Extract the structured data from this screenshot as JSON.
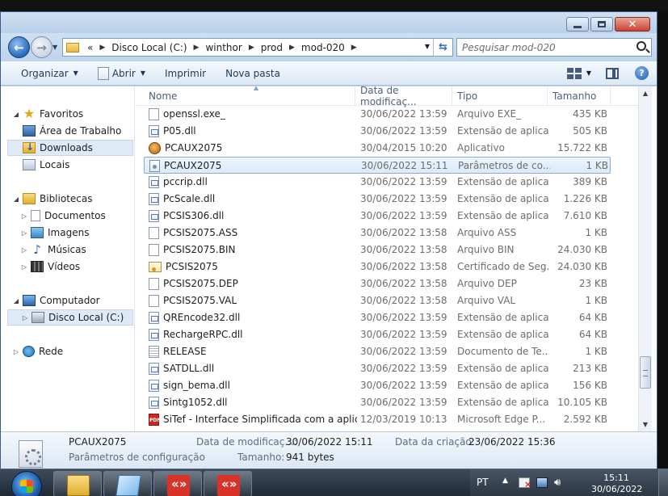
{
  "window": {
    "address_crumbs": [
      "Disco Local (C:)",
      "winthor",
      "prod",
      "mod-020"
    ],
    "search_placeholder": "Pesquisar mod-020",
    "address_overflow": "«"
  },
  "toolbar": {
    "organize": "Organizar",
    "open": "Abrir",
    "print": "Imprimir",
    "new_folder": "Nova pasta"
  },
  "navpane": {
    "favorites": "Favoritos",
    "desktop": "Área de Trabalho",
    "downloads": "Downloads",
    "places": "Locais",
    "libraries": "Bibliotecas",
    "documents": "Documentos",
    "images": "Imagens",
    "music": "Músicas",
    "videos": "Vídeos",
    "computer": "Computador",
    "local_disk": "Disco Local (C:)",
    "network": "Rede"
  },
  "columns": {
    "name": "Nome",
    "date": "Data de modificaç...",
    "type": "Tipo",
    "size": "Tamanho"
  },
  "files": [
    {
      "name": "openssl.exe_",
      "date": "30/06/2022 13:59",
      "type": "Arquivo EXE_",
      "size": "435 KB",
      "icon": "file"
    },
    {
      "name": "P05.dll",
      "date": "30/06/2022 13:59",
      "type": "Extensão de aplica...",
      "size": "505 KB",
      "icon": "dll"
    },
    {
      "name": "PCAUX2075",
      "date": "30/04/2015 10:20",
      "type": "Aplicativo",
      "size": "15.722 KB",
      "icon": "app"
    },
    {
      "name": "PCAUX2075",
      "date": "30/06/2022 15:11",
      "type": "Parâmetros de co...",
      "size": "1 KB",
      "icon": "cfg",
      "selected": true
    },
    {
      "name": "pccrip.dll",
      "date": "30/06/2022 13:59",
      "type": "Extensão de aplica...",
      "size": "389 KB",
      "icon": "dll"
    },
    {
      "name": "PcScale.dll",
      "date": "30/06/2022 13:59",
      "type": "Extensão de aplica...",
      "size": "1.226 KB",
      "icon": "dll"
    },
    {
      "name": "PCSIS306.dll",
      "date": "30/06/2022 13:59",
      "type": "Extensão de aplica...",
      "size": "7.610 KB",
      "icon": "dll"
    },
    {
      "name": "PCSIS2075.ASS",
      "date": "30/06/2022 13:58",
      "type": "Arquivo ASS",
      "size": "1 KB",
      "icon": "file"
    },
    {
      "name": "PCSIS2075.BIN",
      "date": "30/06/2022 13:58",
      "type": "Arquivo BIN",
      "size": "24.030 KB",
      "icon": "file"
    },
    {
      "name": "PCSIS2075",
      "date": "30/06/2022 13:58",
      "type": "Certificado de Seg...",
      "size": "24.030 KB",
      "icon": "cert"
    },
    {
      "name": "PCSIS2075.DEP",
      "date": "30/06/2022 13:58",
      "type": "Arquivo DEP",
      "size": "23 KB",
      "icon": "file"
    },
    {
      "name": "PCSIS2075.VAL",
      "date": "30/06/2022 13:58",
      "type": "Arquivo VAL",
      "size": "1 KB",
      "icon": "file"
    },
    {
      "name": "QREncode32.dll",
      "date": "30/06/2022 13:59",
      "type": "Extensão de aplica...",
      "size": "64 KB",
      "icon": "dll"
    },
    {
      "name": "RechargeRPC.dll",
      "date": "30/06/2022 13:59",
      "type": "Extensão de aplica...",
      "size": "64 KB",
      "icon": "dll"
    },
    {
      "name": "RELEASE",
      "date": "30/06/2022 13:59",
      "type": "Documento de Te...",
      "size": "1 KB",
      "icon": "txt"
    },
    {
      "name": "SATDLL.dll",
      "date": "30/06/2022 13:59",
      "type": "Extensão de aplica...",
      "size": "213 KB",
      "icon": "dll"
    },
    {
      "name": "sign_bema.dll",
      "date": "30/06/2022 13:59",
      "type": "Extensão de aplica...",
      "size": "156 KB",
      "icon": "dll"
    },
    {
      "name": "Sintg1052.dll",
      "date": "30/06/2022 13:59",
      "type": "Extensão de aplica...",
      "size": "10.105 KB",
      "icon": "dll"
    },
    {
      "name": "SiTef - Interface Simplificada com a aplic...",
      "date": "12/03/2019 10:13",
      "type": "Microsoft Edge P...",
      "size": "2.592 KB",
      "icon": "pdf"
    }
  ],
  "details": {
    "name": "PCAUX2075",
    "type": "Parâmetros de configuração",
    "modified_label": "Data de modificaç...:",
    "modified_value": "30/06/2022 15:11",
    "created_label": "Data da criação:",
    "created_value": "23/06/2022 15:36",
    "size_label": "Tamanho:",
    "size_value": "941 bytes"
  },
  "taskbar": {
    "lang": "PT",
    "time": "15:11",
    "date": "30/06/2022"
  },
  "colors": {
    "selection_border": "#84acdd",
    "taskbar_app": "#d93229"
  }
}
